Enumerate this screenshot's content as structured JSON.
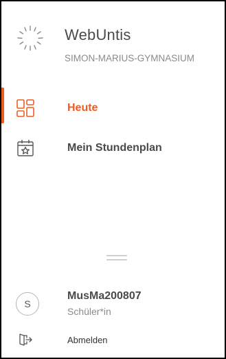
{
  "brand": {
    "logo_icon": "webuntis-sunburst-logo",
    "title": "WebUntis",
    "school": "SIMON-MARIUS-GYMNASIUM"
  },
  "nav": {
    "items": [
      {
        "label": "Heute",
        "icon": "dashboard-grid-icon",
        "active": true
      },
      {
        "label": "Mein Stundenplan",
        "icon": "calendar-star-icon",
        "active": false
      }
    ]
  },
  "user": {
    "avatar_initial": "S",
    "name": "MusMa200807",
    "role": "Schüler*in"
  },
  "logout": {
    "icon": "logout-door-icon",
    "label": "Abmelden"
  },
  "colors": {
    "accent": "#f15a22",
    "text": "#4a4a4a",
    "muted": "#8a8a8a"
  }
}
